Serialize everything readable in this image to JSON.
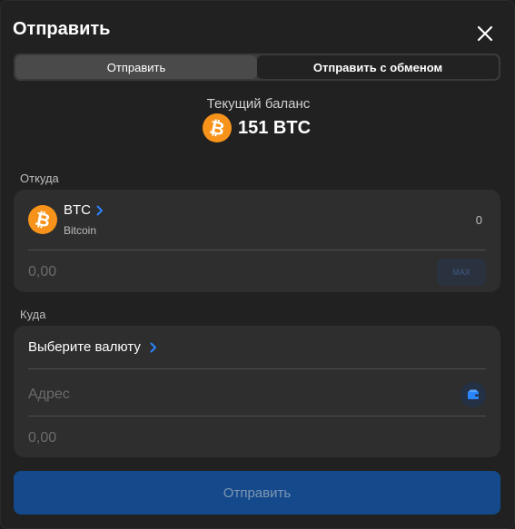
{
  "dialog": {
    "title": "Отправить",
    "close_icon": "close-icon"
  },
  "tabs": [
    {
      "label": "Отправить",
      "active": false
    },
    {
      "label": "Отправить с обменом",
      "active": true
    }
  ],
  "balance": {
    "label": "Текущий баланс",
    "value": "151 BTC",
    "icon": "bitcoin-icon"
  },
  "from": {
    "section_label": "Откуда",
    "currency_symbol": "BTC",
    "currency_name": "Bitcoin",
    "available": "0",
    "amount_placeholder": "0,00",
    "max_label": "MAX",
    "icon": "bitcoin-icon"
  },
  "to": {
    "section_label": "Куда",
    "select_label": "Выберите валюту",
    "address_placeholder": "Адрес",
    "address_icon": "wallet-icon",
    "amount_placeholder": "0,00"
  },
  "submit": {
    "label": "Отправить"
  },
  "colors": {
    "accent": "#1a6fd6",
    "bitcoin": "#f7931a",
    "background": "#212121",
    "card": "#2e2e2e",
    "button_disabled": "#144a8c"
  }
}
